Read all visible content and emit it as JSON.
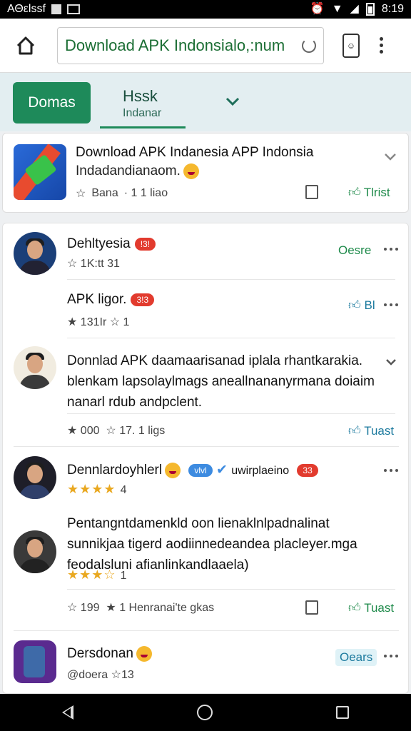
{
  "statusbar": {
    "left_text": "ΑΘεlssf",
    "time": "8:19"
  },
  "browser": {
    "url_text": "Download APK Indonsialo,:num",
    "tab_icon_text": "☺"
  },
  "tabs": {
    "active_label": "Domas",
    "second_title": "Hssk",
    "second_subtitle": "Indanar"
  },
  "app_card": {
    "title": "Download APK Indanesia APP Indonsia",
    "subtitle": "Indadandianaom.",
    "rating_text": "Bana",
    "dot_text": "· 1 1 liao",
    "like_text": "Tlrist"
  },
  "feed": {
    "rows": [
      {
        "name": "Dehltyesia",
        "badge": "!3!",
        "stat1": "1K:tt 31",
        "action": "Oesre"
      },
      {
        "name": "APK ligor.",
        "badge": "3!3",
        "stat1": "131Ir",
        "stat2": "1",
        "action": "Bl"
      },
      {
        "paragraph": "Donnlad APK daamaarisanad iplala rhantkarakia. blenkam lapsolaylmags aneallnananyrmana doiaim nanarl rdub andpclent.",
        "highlight": "APK",
        "stat1": "000",
        "stat2": "17. 1 ligs",
        "action": "Tuast"
      },
      {
        "name": "Dennlardoyhlerl",
        "chip1": "vlvl",
        "chip2": "uwirplaeino",
        "badge": "33",
        "stars_count": "4"
      },
      {
        "paragraph": "Pentangntdamenkld oon lienaklnlpadnalinat sunnikjaa tigerd aodiinnedeandea placleyer.mga feodalsluni afianlinkandlaaela)",
        "stars_count": "1",
        "stat1": "199",
        "stat2": "1 Henranai'te gkas",
        "action": "Tuast"
      },
      {
        "name": "Dersdonan",
        "meta": "@doera",
        "stat": "13",
        "action": "Oears"
      }
    ]
  },
  "colors": {
    "accent": "#1e8a5a",
    "link": "#1c7a9e",
    "badge_red": "#e23b2e",
    "star": "#e9a820"
  },
  "icons": [
    "home-icon",
    "reload-icon",
    "tab-switcher-icon",
    "menu-dots-icon",
    "chevron-down-icon",
    "star-icon",
    "thumb-up-icon",
    "doc-icon",
    "back-icon",
    "home-circle-icon",
    "recents-icon"
  ]
}
